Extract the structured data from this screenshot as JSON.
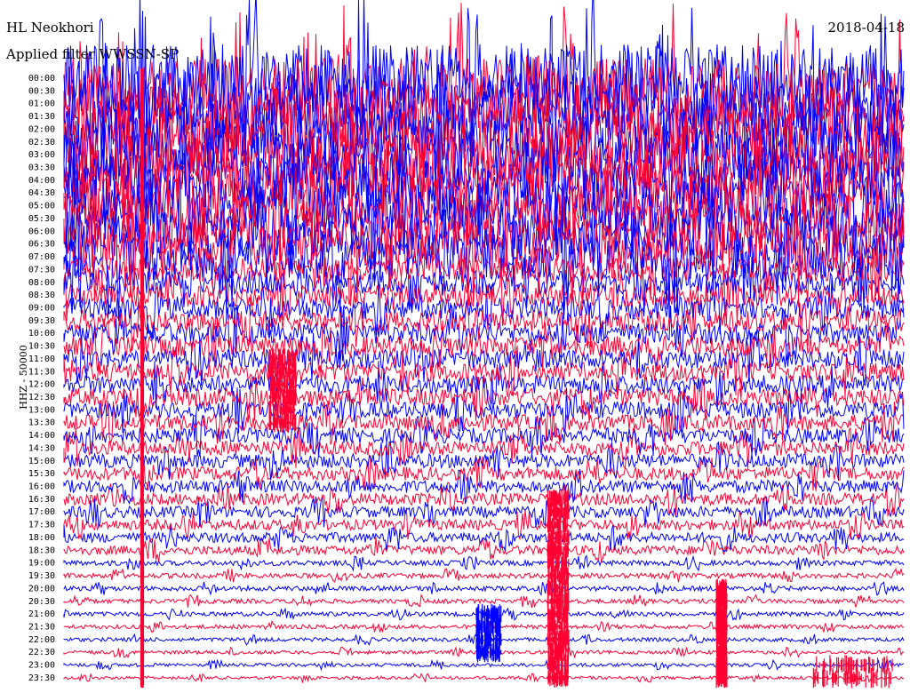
{
  "header": {
    "station": "HL Neokhori",
    "filter": "Applied filter WWSSN-SP",
    "date": "2018-04-18",
    "ylabel": "HHZ - 50000"
  },
  "colors": {
    "even_line": "#0000ff",
    "odd_line": "#ff0033",
    "background": "#ffffff"
  },
  "chart_data": {
    "type": "line",
    "title": "HL Neokhori",
    "subtitle": "Applied filter WWSSN-SP",
    "date": "2018-04-18",
    "ylabel": "HHZ - 50000",
    "row_labels": [
      "00:00",
      "00:30",
      "01:00",
      "01:30",
      "02:00",
      "02:30",
      "03:00",
      "03:30",
      "04:00",
      "04:30",
      "05:00",
      "05:30",
      "06:00",
      "06:30",
      "07:00",
      "07:30",
      "08:00",
      "08:30",
      "09:00",
      "09:30",
      "10:00",
      "10:30",
      "11:00",
      "11:30",
      "12:00",
      "12:30",
      "13:00",
      "13:30",
      "14:00",
      "14:30",
      "15:00",
      "15:30",
      "16:00",
      "16:30",
      "17:00",
      "17:30",
      "18:00",
      "18:30",
      "19:00",
      "19:30",
      "20:00",
      "20:30",
      "21:00",
      "21:30",
      "22:00",
      "22:30",
      "23:00",
      "23:30"
    ],
    "row_minutes": 30,
    "series_colors": [
      "#0000ff",
      "#ff0033"
    ],
    "grid": false
  }
}
